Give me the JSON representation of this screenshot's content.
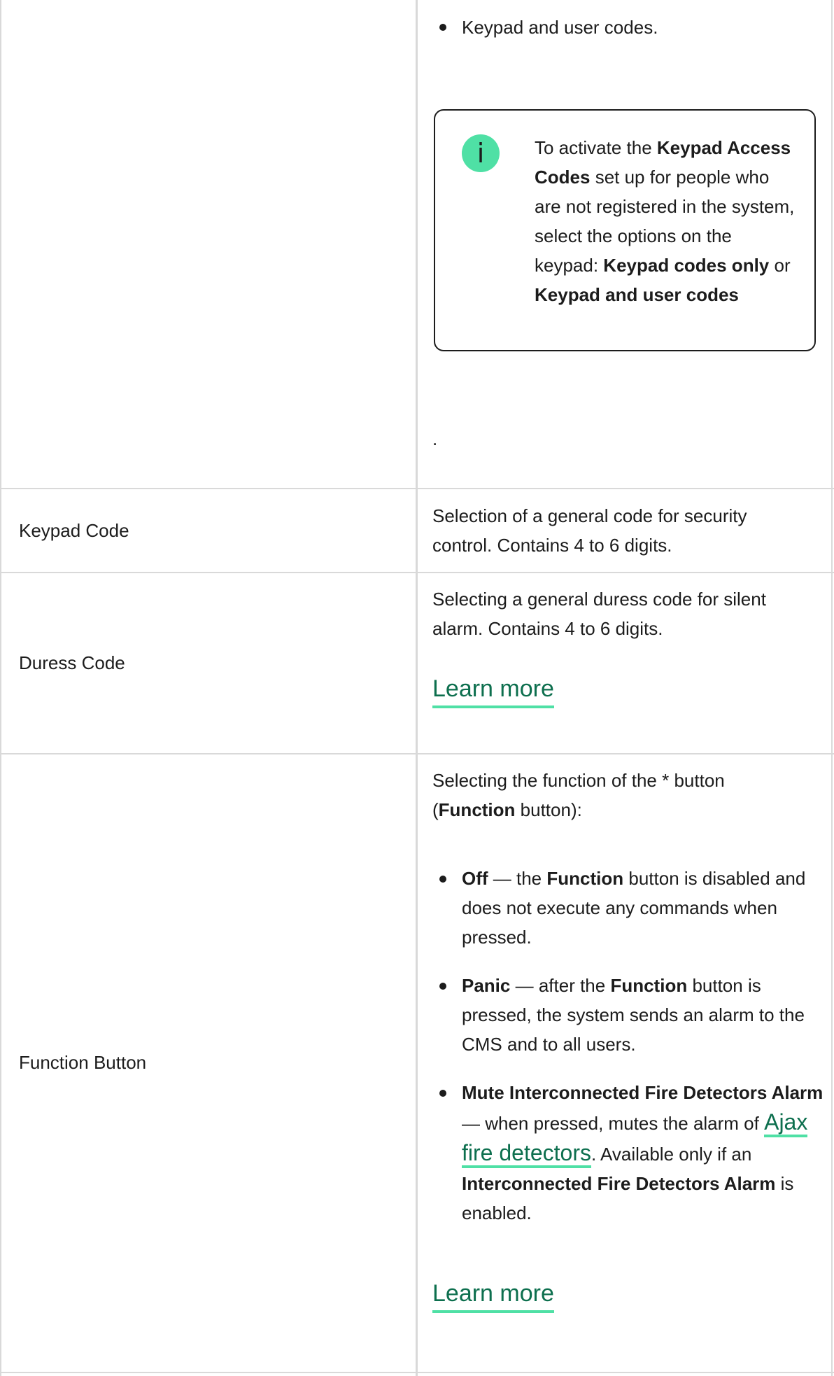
{
  "top_cell": {
    "bullet_text": "Keypad and user codes.",
    "note": {
      "icon": "info-icon",
      "icon_glyph": "i",
      "pre": "To activate the ",
      "b1": "Keypad Access Codes",
      "mid": " set up for people who are not registered in the system, select the options on the keypad: ",
      "b2": "Keypad codes only",
      "or": " or ",
      "b3": "Keypad and user codes"
    },
    "trailing_dot": "."
  },
  "rows": {
    "keypad_code": {
      "label": "Keypad Code",
      "desc": "Selection of a general code for security control. Contains 4 to 6 digits."
    },
    "duress_code": {
      "label": "Duress Code",
      "desc": "Selecting a general duress code for silent alarm. Contains 4 to 6 digits.",
      "link": "Learn more"
    },
    "function_button": {
      "label": "Function Button",
      "intro_pre": "Selecting the function of the * button (",
      "intro_b": "Function",
      "intro_post": " button):",
      "off_b": "Off",
      "off_mid": " — the ",
      "off_b2": "Function",
      "off_post": " button is disabled and does not execute any commands when pressed.",
      "panic_b": "Panic",
      "panic_mid": " — after the ",
      "panic_b2": "Function",
      "panic_post": " button is pressed, the system sends an alarm to the CMS and to all users.",
      "mute_b": "Mute Interconnected Fire Detectors Alarm",
      "mute_mid": " — when pressed, mutes the alarm of ",
      "mute_link": "Ajax fire detectors",
      "mute_mid2": ". Available only if an ",
      "mute_b2": "Interconnected Fire Detectors Alarm",
      "mute_post": " is enabled.",
      "link": "Learn more"
    }
  },
  "colors": {
    "accent": "#4fe0a5",
    "link": "#0d6f4e",
    "border": "#d9d9d9"
  }
}
